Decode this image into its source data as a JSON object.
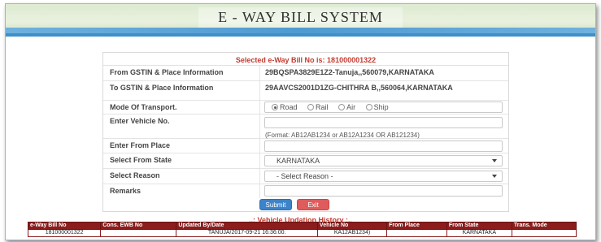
{
  "header": {
    "title": "E - WAY BILL SYSTEM"
  },
  "form": {
    "selected_title": "Selected e-Way Bill No is: 181000001322",
    "from_label": "From GSTIN & Place Information",
    "from_value": "29BQSPA3829E1Z2-Tanuja,,560079,KARNATAKA",
    "to_label": "To GSTIN & Place Information",
    "to_value": "29AAVCS2001D1ZG-CHITHRA B,,560064,KARNATAKA",
    "mode_label": "Mode Of Transport.",
    "modes": [
      {
        "label": "Road",
        "selected": true
      },
      {
        "label": "Rail",
        "selected": false
      },
      {
        "label": "Air",
        "selected": false
      },
      {
        "label": "Ship",
        "selected": false
      }
    ],
    "vehicle_label": "Enter Vehicle No.",
    "vehicle_value": "",
    "vehicle_hint": "(Format: AB12AB1234 or AB12A1234 OR AB121234)",
    "from_place_label": "Enter From Place",
    "from_place_value": "",
    "from_state_label": "Select From State",
    "from_state_value": "KARNATAKA",
    "reason_label": "Select Reason",
    "reason_value": "- Select Reason -",
    "remarks_label": "Remarks",
    "remarks_value": "",
    "submit_label": "Submit",
    "exit_label": "Exit"
  },
  "history": {
    "title": "..: Vehicle Updation History :..",
    "columns": [
      "e-Way Bill No",
      "Cons. EWB No",
      "Updated By/Date",
      "Vehicle No",
      "From Place",
      "From State",
      "Trans. Mode"
    ],
    "rows": [
      [
        "181000001322",
        "",
        "TANUJA/2017-09-21 16:36:00.",
        "KA12AB1234)",
        "",
        "KARNATAKA",
        ""
      ]
    ]
  }
}
